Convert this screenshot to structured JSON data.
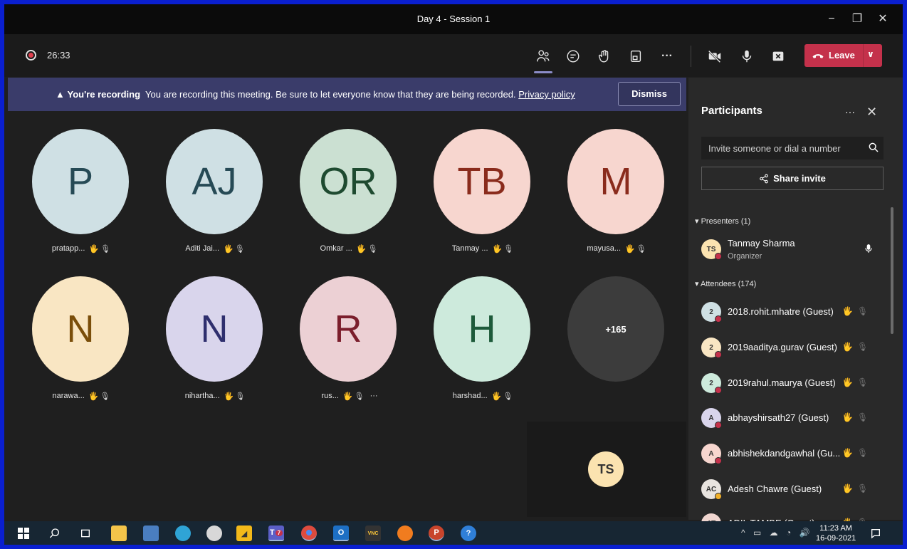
{
  "window": {
    "title": "Day 4 - Session 1",
    "controls": [
      "−",
      "❐",
      "✕"
    ]
  },
  "toolbar": {
    "timer": "26:33",
    "leave_label": "Leave",
    "icons": [
      "people-icon",
      "chat-icon",
      "raise-hand-icon",
      "share-tray-icon",
      "more-icon",
      "camera-off-icon",
      "mic-icon",
      "share-screen-icon"
    ]
  },
  "banner": {
    "title": "You're recording",
    "message": "You are recording this meeting. Be sure to let everyone know that they are being recorded.",
    "link": "Privacy policy",
    "dismiss_label": "Dismiss"
  },
  "grid": {
    "tiles": [
      {
        "initials": "P",
        "name": "pratapp...",
        "bg": "#cfe0e4",
        "fg": "#264a55"
      },
      {
        "initials": "AJ",
        "name": "Aditi Jai...",
        "bg": "#cfe0e4",
        "fg": "#264a55"
      },
      {
        "initials": "OR",
        "name": "Omkar ...",
        "bg": "#cbe0d2",
        "fg": "#1e4a30"
      },
      {
        "initials": "TB",
        "name": "Tanmay ...",
        "bg": "#f7d6cf",
        "fg": "#8a2b1c"
      },
      {
        "initials": "M",
        "name": "mayusa...",
        "bg": "#f7d6cf",
        "fg": "#8a2b1c"
      },
      {
        "initials": "N",
        "name": "narawa...",
        "bg": "#f9e6c3",
        "fg": "#7a4e0a"
      },
      {
        "initials": "N",
        "name": "nihartha...",
        "bg": "#d9d5ec",
        "fg": "#2f2f6e"
      },
      {
        "initials": "R",
        "name": "rus...",
        "bg": "#ecd0d4",
        "fg": "#7b1e2c"
      },
      {
        "initials": "H",
        "name": "harshad...",
        "bg": "#cdeadc",
        "fg": "#1d5a3a"
      },
      {
        "initials": "+165",
        "name": "",
        "bg": "#3c3c3c",
        "fg": "#ffffff"
      }
    ],
    "more_suffix": "···",
    "self_initials": "TS"
  },
  "panel": {
    "title": "Participants",
    "more": "···",
    "invite_placeholder": "Invite someone or dial a number",
    "share_label": "Share invite",
    "presenters_label": "Presenters (1)",
    "attendees_label": "Attendees (174)",
    "presenters": [
      {
        "initials": "TS",
        "name": "Tanmay Sharma",
        "role": "Organizer",
        "bg": "#fbe3b0"
      }
    ],
    "attendees": [
      {
        "initials": "2",
        "name": "2018.rohit.mhatre (Guest)",
        "bg": "#cfe0e4",
        "status": "busy"
      },
      {
        "initials": "2",
        "name": "2019aaditya.gurav (Guest)",
        "bg": "#f9e6c3",
        "status": "busy"
      },
      {
        "initials": "2",
        "name": "2019rahul.maurya (Guest)",
        "bg": "#cdeadc",
        "status": "busy"
      },
      {
        "initials": "A",
        "name": "abhayshirsath27 (Guest)",
        "bg": "#d9d5ec",
        "status": "busy"
      },
      {
        "initials": "A",
        "name": "abhishekdandgawhal (Gu...",
        "bg": "#f7d6cf",
        "status": "busy"
      },
      {
        "initials": "AC",
        "name": "Adesh Chawre (Guest)",
        "bg": "#e8e4df",
        "status": "away"
      },
      {
        "initials": "AT",
        "name": "ADIL TAMBE (Guest)",
        "bg": "#f0d6d0",
        "status": "busy"
      }
    ]
  },
  "taskbar": {
    "time": "11:23 AM",
    "date": "16-09-2021",
    "apps": [
      "windows-icon",
      "search-icon",
      "task-view-icon",
      "file-explorer-icon",
      "remote-desktop-icon",
      "app-icon",
      "clock-icon",
      "sticky-notes-icon",
      "teams-icon",
      "chrome-icon",
      "outlook-icon",
      "vnc-icon",
      "vlc-icon",
      "powerpoint-icon",
      "help-icon"
    ],
    "teams_badge": "7"
  }
}
